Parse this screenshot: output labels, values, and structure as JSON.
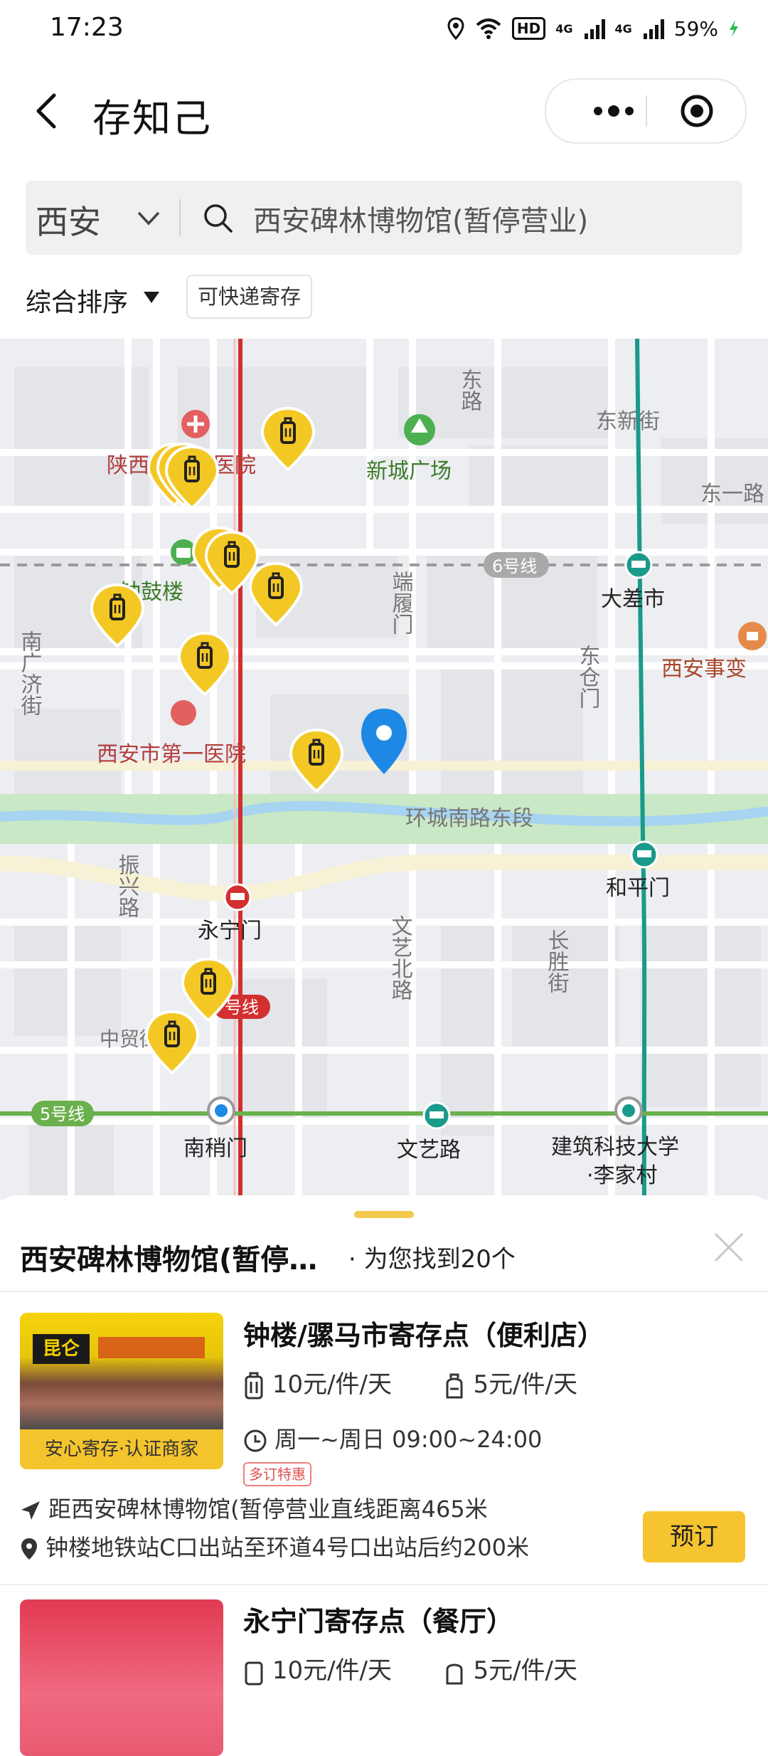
{
  "status_bar": {
    "time": "17:23",
    "battery": "59%",
    "hd": "HD",
    "network1": "4G",
    "network2": "4G"
  },
  "nav": {
    "title": "存知己"
  },
  "search": {
    "city": "西安",
    "query": "西安碑林博物馆(暂停营业)"
  },
  "filters": {
    "sort_label": "综合排序",
    "express_label": "可快递寄存"
  },
  "map": {
    "labels": {
      "shaanxi_tcm_hospital": "陕西省中医医院",
      "xincheng_square": "新城广场",
      "dongxin_street": "东新街",
      "dongyi_road": "东一路",
      "line6": "6号线",
      "dachashi": "大差市",
      "zhonggulou": "钟鼓楼",
      "duanlumen": "端履门",
      "dongcangmen": "东仓门",
      "xian_incident": "西安事变",
      "nanguangji_street": "南广济街",
      "xian_first_hospital": "西安市第一医院",
      "huancheng_s_rd_east": "环城南路东段",
      "zhenxing_road": "振兴路",
      "yongningmen": "永宁门",
      "hepingmen": "和平门",
      "wenyi_north_road": "文艺北路",
      "changsheng_street": "长胜街",
      "line2_badge": "号线",
      "zhongmao": "中贸街",
      "line5": "5号线",
      "nanshaomen": "南稍门",
      "wenyilu": "文艺路",
      "jianzhu_univ_1": "建筑科技大学",
      "jianzhu_univ_2": "·李家村",
      "top_road": "东路"
    }
  },
  "sheet": {
    "title": "西安碑林博物馆(暂停…",
    "result_count": "· 为您找到20个",
    "items": [
      {
        "name": "钟楼/骡马市寄存点（便利店）",
        "price_large": "10元/件/天",
        "price_small": "5元/件/天",
        "hours": "周一~周日 09:00~24:00",
        "promo": "多订特惠",
        "badge": "安心寄存·认证商家",
        "thumb_sign": "昆仑",
        "distance": "距西安碑林博物馆(暂停营业直线距离465米",
        "directions": "钟楼地铁站C口出站至环道4号口出站后约200米",
        "book_label": "预订"
      },
      {
        "name": "永宁门寄存点（餐厅）",
        "price_large": "10元/件/天",
        "price_small": "5元/件/天"
      }
    ]
  },
  "colors": {
    "accent": "#f6c42f",
    "pin_blue": "#1e88e5",
    "metro_line2": "#d32f2f",
    "metro_line4": "#1a9a8a",
    "metro_line5": "#6ab04c"
  }
}
